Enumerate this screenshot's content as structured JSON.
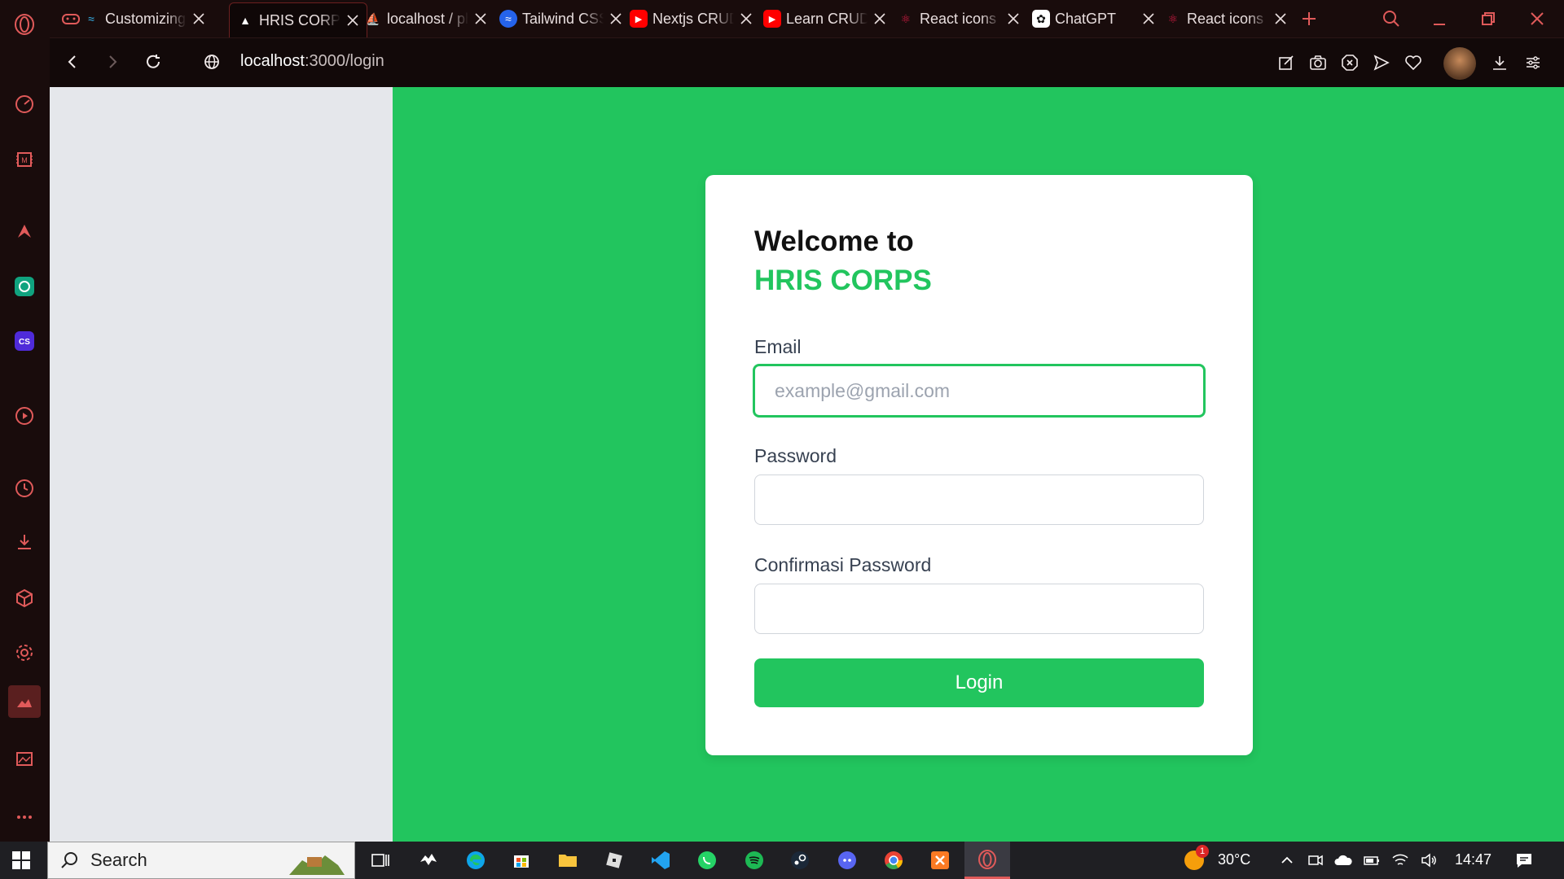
{
  "browser": {
    "tabs": [
      {
        "label": "Customizing",
        "favicon": "tailwind-icon",
        "color": "#38bdf8"
      },
      {
        "label": "HRIS CORPS",
        "favicon": "vercel-icon",
        "color": "#ffffff",
        "active": true
      },
      {
        "label": "localhost / phpMyAdmin",
        "favicon": "phpmyadmin-icon",
        "color": "#f59e0b"
      },
      {
        "label": "Tailwind CSS",
        "favicon": "tailwind-icon",
        "color": "#2563eb"
      },
      {
        "label": "Nextjs CRUD",
        "favicon": "youtube-icon",
        "color": "#ff0000"
      },
      {
        "label": "Learn CRUD",
        "favicon": "youtube-icon",
        "color": "#ff0000"
      },
      {
        "label": "React icons",
        "favicon": "react-icon",
        "color": "#e11d48"
      },
      {
        "label": "ChatGPT",
        "favicon": "chatgpt-icon",
        "color": "#ffffff"
      },
      {
        "label": "React icons",
        "favicon": "react-icon",
        "color": "#e11d48"
      }
    ],
    "url_host": "localhost",
    "url_path": ":3000/login"
  },
  "page": {
    "welcome": "Welcome to",
    "brand": "HRIS CORPS",
    "email_label": "Email",
    "email_placeholder": "example@gmail.com",
    "password_label": "Password",
    "confirm_label": "Confirmasi Password",
    "login_button": "Login",
    "accent_color": "#22c55e"
  },
  "taskbar": {
    "search_label": "Search",
    "temperature": "30°C",
    "time": "14:47",
    "weather_badge": "1"
  }
}
